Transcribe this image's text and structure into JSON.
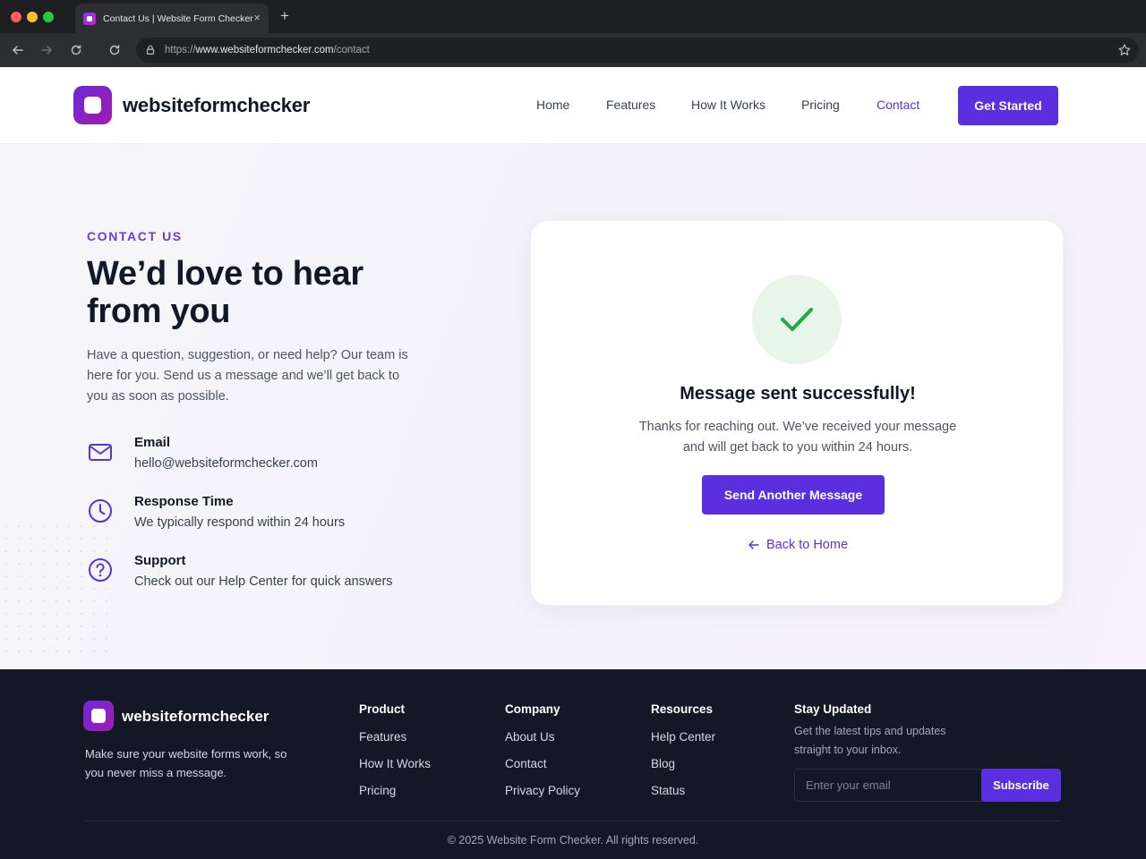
{
  "browser": {
    "tab_title": "Contact Us | Website Form Checker",
    "tab_close": "×",
    "new_tab": "+",
    "url_prefix": "https://",
    "url_domain": "www.websiteformchecker.com",
    "url_path": "/contact"
  },
  "header": {
    "logo_text": "websiteformchecker",
    "nav": [
      "Home",
      "Features",
      "How It Works",
      "Pricing",
      "Contact"
    ],
    "active_nav": "Contact",
    "cta": "Get Started"
  },
  "contact": {
    "eyebrow": "CONTACT US",
    "headline": "We’d love to hear from you",
    "lead": "Have a question, suggestion, or need help? Our team is here for you. Send us a message and we’ll get back to you as soon as possible.",
    "items": [
      {
        "icon": "mail-icon",
        "title": "Email",
        "desc": "hello@websiteformchecker.com"
      },
      {
        "icon": "clock-icon",
        "title": "Response Time",
        "desc": "We typically respond within 24 hours"
      },
      {
        "icon": "help-circle-icon",
        "title": "Support",
        "desc": "Check out our Help Center for quick answers"
      }
    ]
  },
  "success": {
    "title": "Message sent successfully!",
    "text": "Thanks for reaching out. We’ve received your message and will get back to you within 24 hours.",
    "button": "Send Another Message",
    "back_link": "Back to Home"
  },
  "footer": {
    "logo_text": "websiteformchecker",
    "tagline": "Make sure your website forms work, so you never miss a message.",
    "columns": [
      {
        "title": "Product",
        "links": [
          "Features",
          "How It Works",
          "Pricing"
        ]
      },
      {
        "title": "Company",
        "links": [
          "About Us",
          "Contact",
          "Privacy Policy"
        ]
      },
      {
        "title": "Resources",
        "links": [
          "Help Center",
          "Blog",
          "Status"
        ]
      }
    ],
    "newsletter": {
      "title": "Stay Updated",
      "text": "Get the latest tips and updates straight to your inbox.",
      "placeholder": "Enter your email",
      "button": "Subscribe"
    },
    "copyright": "© 2025 Website Form Checker. All rights reserved."
  },
  "colors": {
    "brand": "#5b2ee0",
    "accent_text": "#5b32d6",
    "success_green": "#22a845",
    "footer_bg": "#131827"
  }
}
